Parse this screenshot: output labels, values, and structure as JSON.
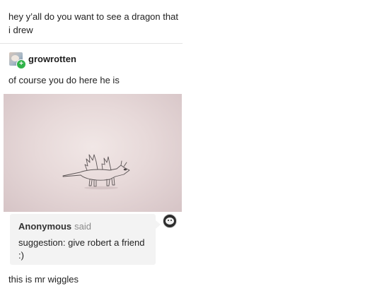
{
  "op_post": {
    "text": "hey y’all do you want to see a dragon that i drew"
  },
  "reblog": {
    "username": "growrotten",
    "avatar_icon": "blog-avatar-icon",
    "badge_icon": "follow-badge-icon",
    "badge_glyph": "+",
    "text": "of course you do here he is"
  },
  "photo": {
    "subject": "dragon-drawing"
  },
  "ask": {
    "asker": "Anonymous",
    "said_label": "said",
    "question": "suggestion: give robert a friend :)",
    "avatar_icon": "anonymous-avatar-icon"
  },
  "answer": {
    "text": "this is mr wiggles"
  },
  "colors": {
    "follow_badge": "#31b34a",
    "ask_bubble": "#f3f3f3",
    "said_text": "#8a8a8a"
  }
}
